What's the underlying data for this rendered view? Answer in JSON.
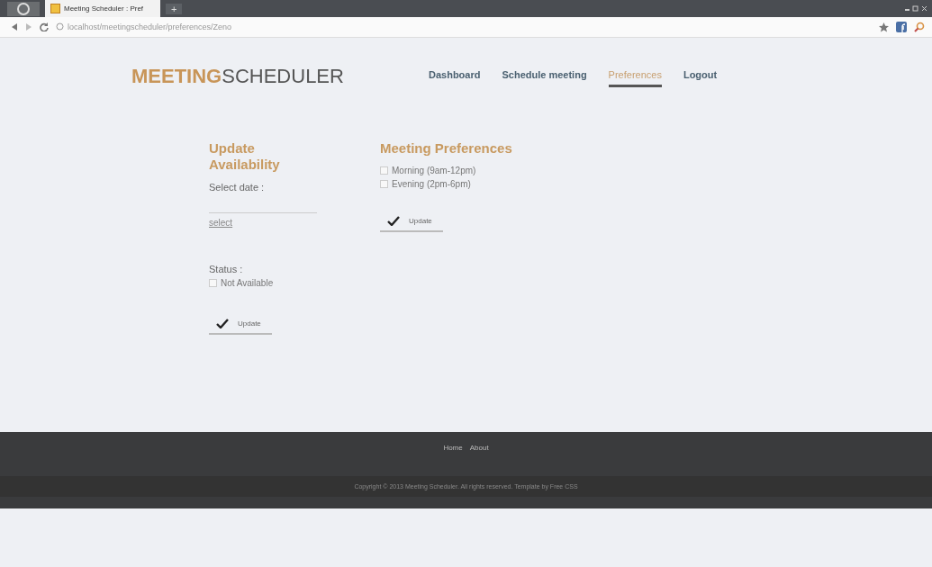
{
  "browser": {
    "tab_title": "Meeting Scheduler : Pref",
    "new_tab": "+",
    "url": "localhost/meetingscheduler/preferences/Zeno"
  },
  "header": {
    "logo_accent": "MEETING",
    "logo_rest": "SCHEDULER",
    "nav": [
      {
        "label": "Dashboard",
        "selected": false
      },
      {
        "label": "Schedule meeting",
        "selected": false
      },
      {
        "label": "Preferences",
        "selected": true
      },
      {
        "label": "Logout",
        "selected": false
      }
    ]
  },
  "availability": {
    "title": "Update Availability",
    "date_label": "Select date :",
    "date_link": "select",
    "status_label": "Status :",
    "status_option": {
      "label": "Not Available",
      "checked": false
    },
    "button": "Update"
  },
  "preferences": {
    "title": "Meeting Preferences",
    "options": [
      {
        "label": "Morning (9am-12pm)",
        "checked": false
      },
      {
        "label": "Evening (2pm-6pm)",
        "checked": false
      }
    ],
    "button": "Update"
  },
  "footer": {
    "links": [
      "Home",
      "About"
    ],
    "copyright": "Copyright © 2013 Meeting Scheduler. All rights reserved. Template by Free CSS"
  }
}
